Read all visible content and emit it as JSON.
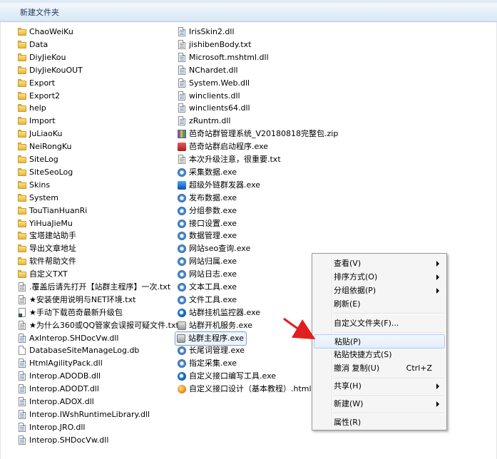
{
  "toolbar": {
    "new_folder_label": "新建文件夹"
  },
  "files_col1": [
    {
      "name": "ChaoWeiKu",
      "icon": "folder-icon"
    },
    {
      "name": "Data",
      "icon": "folder-icon"
    },
    {
      "name": "DiyJieKou",
      "icon": "folder-icon"
    },
    {
      "name": "DiyJieKouOUT",
      "icon": "folder-icon"
    },
    {
      "name": "Export",
      "icon": "folder-icon"
    },
    {
      "name": "Export2",
      "icon": "folder-icon"
    },
    {
      "name": "help",
      "icon": "folder-icon"
    },
    {
      "name": "Import",
      "icon": "folder-icon"
    },
    {
      "name": "JuLiaoKu",
      "icon": "folder-icon"
    },
    {
      "name": "NeiRongKu",
      "icon": "folder-icon"
    },
    {
      "name": "SiteLog",
      "icon": "folder-icon"
    },
    {
      "name": "SiteSeoLog",
      "icon": "folder-icon"
    },
    {
      "name": "Skins",
      "icon": "folder-icon"
    },
    {
      "name": "System",
      "icon": "folder-icon"
    },
    {
      "name": "TouTianHuanRi",
      "icon": "folder-icon"
    },
    {
      "name": "YiHuaJieMu",
      "icon": "folder-icon"
    },
    {
      "name": "宝塔建站助手",
      "icon": "folder-icon"
    },
    {
      "name": "导出文章地址",
      "icon": "folder-icon"
    },
    {
      "name": "软件帮助文件",
      "icon": "folder-icon"
    },
    {
      "name": "自定义TXT",
      "icon": "folder-icon"
    },
    {
      "name": ".覆盖后请先打开【站群主程序】一次.txt",
      "icon": "text-file-icon"
    },
    {
      "name": "★安装使用说明与NET环境.txt",
      "icon": "text-file-icon"
    },
    {
      "name": "★手动下载芭奇最新升级包",
      "icon": "shortcut-icon"
    },
    {
      "name": "★为什么360或QQ管家会误报可疑文件.txt",
      "icon": "text-file-icon"
    },
    {
      "name": "AxInterop.SHDocVw.dll",
      "icon": "dll-file-icon"
    },
    {
      "name": "DatabaseSiteManageLog.db",
      "icon": "db-file-icon"
    },
    {
      "name": "HtmlAgilityPack.dll",
      "icon": "dll-file-icon"
    },
    {
      "name": "Interop.ADODB.dll",
      "icon": "dll-file-icon"
    },
    {
      "name": "Interop.ADODT.dll",
      "icon": "dll-file-icon"
    },
    {
      "name": "Interop.ADOX.dll",
      "icon": "dll-file-icon"
    },
    {
      "name": "Interop.IWshRuntimeLibrary.dll",
      "icon": "dll-file-icon"
    },
    {
      "name": "Interop.JRO.dll",
      "icon": "dll-file-icon"
    },
    {
      "name": "Interop.SHDocVw.dll",
      "icon": "dll-file-icon"
    }
  ],
  "files_col2": [
    {
      "name": "IrisSkin2.dll",
      "icon": "dll-file-icon"
    },
    {
      "name": "jishibenBody.txt",
      "icon": "text-file-icon"
    },
    {
      "name": "Microsoft.mshtml.dll",
      "icon": "dll-file-icon"
    },
    {
      "name": "NChardet.dll",
      "icon": "dll-file-icon"
    },
    {
      "name": "System.Web.dll",
      "icon": "dll-file-icon"
    },
    {
      "name": "winclients.dll",
      "icon": "dll-file-icon"
    },
    {
      "name": "winclients64.dll",
      "icon": "dll-file-icon"
    },
    {
      "name": "zRuntm.dll",
      "icon": "dll-file-icon"
    },
    {
      "name": "芭奇站群管理系统_V20180818完整包.zip",
      "icon": "zip-archive-icon"
    },
    {
      "name": "芭奇站群启动程序.exe",
      "icon": "launcher-exe-icon"
    },
    {
      "name": "本次升级注意，很重要.txt",
      "icon": "text-file-icon"
    },
    {
      "name": "采集数据.exe",
      "icon": "gear-exe-icon"
    },
    {
      "name": "超级外链群发器.exe",
      "icon": "link-exe-icon"
    },
    {
      "name": "发布数据.exe",
      "icon": "gear-exe-icon"
    },
    {
      "name": "分组参数.exe",
      "icon": "gear-exe-icon"
    },
    {
      "name": "接口设置.exe",
      "icon": "gear-exe-icon"
    },
    {
      "name": "数据管理.exe",
      "icon": "gear-exe-icon"
    },
    {
      "name": "网站seo查询.exe",
      "icon": "gear-exe-icon"
    },
    {
      "name": "网站归属.exe",
      "icon": "gear-exe-icon"
    },
    {
      "name": "网站日志.exe",
      "icon": "gear-exe-icon"
    },
    {
      "name": "文本工具.exe",
      "icon": "gear-exe-icon"
    },
    {
      "name": "文件工具.exe",
      "icon": "gear-exe-icon"
    },
    {
      "name": "站群挂机监控器.exe",
      "icon": "monitor-exe-icon"
    },
    {
      "name": "站群开机服务.exe",
      "icon": "service-exe-icon"
    },
    {
      "name": "站群主程序.exe",
      "icon": "main-exe-icon",
      "selected": true
    },
    {
      "name": "长尾词管理.exe",
      "icon": "gear-exe-icon"
    },
    {
      "name": "指定采集.exe",
      "icon": "gear-exe-icon"
    },
    {
      "name": "自定义接口编写工具.exe",
      "icon": "magnifier-exe-icon"
    },
    {
      "name": "自定义接口设计（基本教程）.html",
      "icon": "html-file-icon"
    }
  ],
  "context_menu": {
    "items": [
      {
        "label": "查看(V)",
        "submenu": true
      },
      {
        "label": "排序方式(O)",
        "submenu": true
      },
      {
        "label": "分组依据(P)",
        "submenu": true
      },
      {
        "label": "刷新(E)"
      },
      {
        "separator": true
      },
      {
        "label": "自定义文件夹(F)..."
      },
      {
        "separator": true
      },
      {
        "label": "粘贴(P)",
        "highlighted": true
      },
      {
        "label": "粘贴快捷方式(S)"
      },
      {
        "label": "撤消 复制(U)",
        "shortcut": "Ctrl+Z"
      },
      {
        "separator": true
      },
      {
        "label": "共享(H)",
        "submenu": true
      },
      {
        "separator": true
      },
      {
        "label": "新建(W)",
        "submenu": true
      },
      {
        "separator": true
      },
      {
        "label": "属性(R)"
      }
    ]
  },
  "colors": {
    "annotation_arrow": "#e02020",
    "selection_border": "#7da2ce",
    "menu_highlight_border": "#aecff7"
  }
}
